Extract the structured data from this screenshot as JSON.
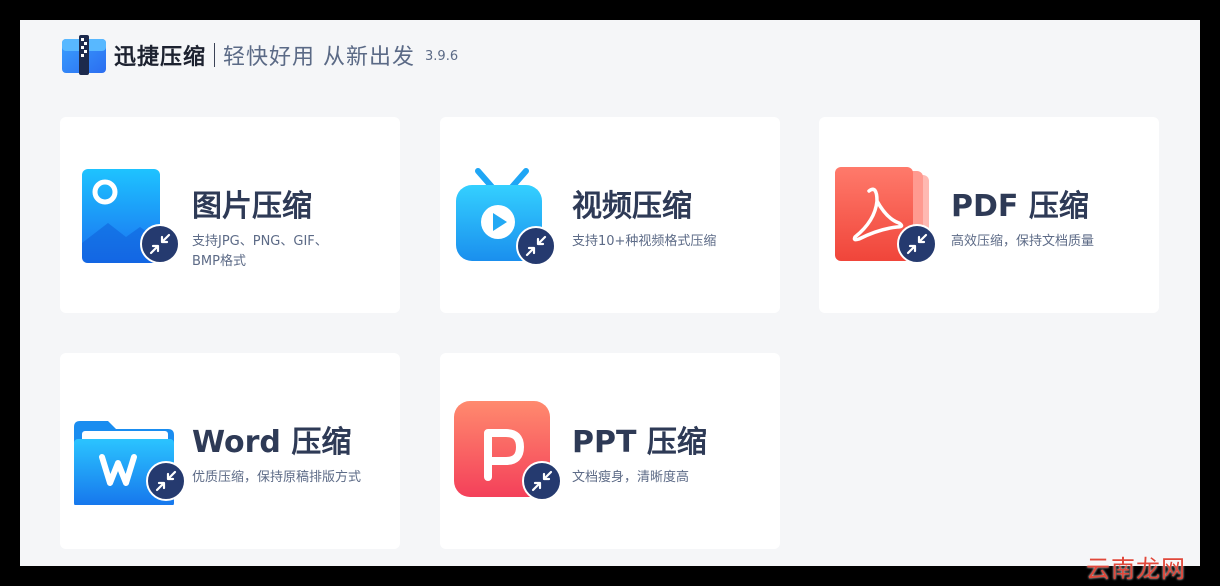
{
  "header": {
    "app_name": "迅捷压缩",
    "slogan": "轻快好用 从新出发",
    "version": "3.9.6"
  },
  "cards": [
    {
      "title": "图片压缩",
      "desc": "支持JPG、PNG、GIF、BMP格式",
      "icon": "image-icon"
    },
    {
      "title": "视频压缩",
      "desc": "支持10+种视频格式压缩",
      "icon": "video-tv-icon"
    },
    {
      "title": "PDF 压缩",
      "desc": "高效压缩，保持文档质量",
      "icon": "pdf-icon"
    },
    {
      "title": "Word 压缩",
      "desc": "优质压缩，保持原稿排版方式",
      "icon": "word-folder-icon"
    },
    {
      "title": "PPT 压缩",
      "desc": "文档瘦身，清晰度高",
      "icon": "ppt-icon"
    }
  ],
  "watermark": "云南龙网",
  "colors": {
    "background": "#f5f6f8",
    "card": "#ffffff",
    "title": "#2e3a56",
    "badge": "#253a6f"
  }
}
